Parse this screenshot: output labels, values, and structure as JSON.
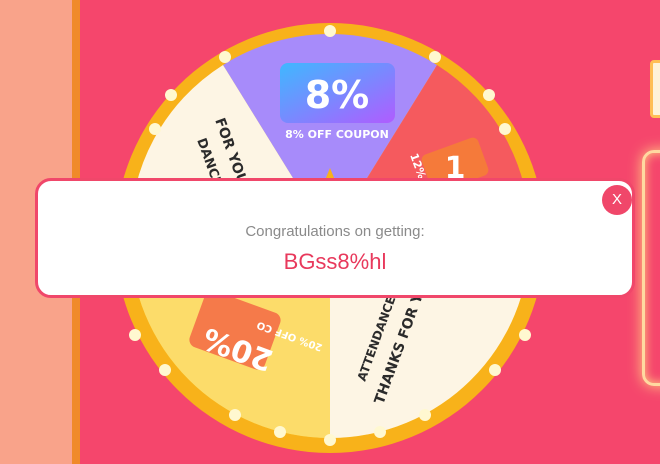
{
  "wheel": {
    "top_segment": {
      "value": "8%",
      "caption": "8% OFF COUPON"
    },
    "left_segment": {
      "line1": "FOR YOU",
      "line2": "DANCE"
    },
    "right_segment": {
      "value": "1",
      "caption": "12%"
    },
    "bottom_left_segment": {
      "value": "20%",
      "caption": "20% OFF CO"
    },
    "bottom_right_segment": {
      "line1": "THANKS FOR YOU",
      "line2": "ATTENDANCE"
    }
  },
  "modal": {
    "message": "Congratulations on getting:",
    "code": "BGss8%hl",
    "close_label": "X"
  },
  "colors": {
    "accent": "#f0476a",
    "code_text": "#e8395c",
    "wheel_rim": "#f8b21a"
  }
}
